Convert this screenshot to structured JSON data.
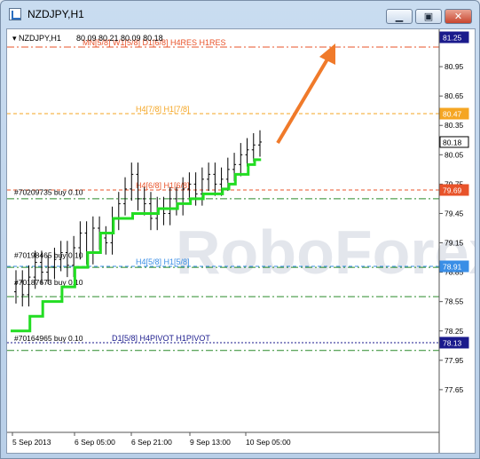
{
  "window": {
    "title": "NZDJPY,H1"
  },
  "chart_data": {
    "type": "line",
    "title": "NZDJPY,H1",
    "ohlc_label": "80.09 80.21 80.09 80.18",
    "symbol_label": "NZDJPY,H1",
    "ylim": [
      77.25,
      81.25
    ],
    "y_ticks": [
      "81.25",
      "80.95",
      "80.65",
      "80.35",
      "80.05",
      "79.75",
      "79.45",
      "79.15",
      "78.85",
      "78.55",
      "78.25",
      "77.95",
      "77.65"
    ],
    "x_ticks": [
      "5 Sep 2013",
      "6 Sep 05:00",
      "6 Sep 21:00",
      "9 Sep 13:00",
      "10 Sep 05:00"
    ],
    "price_tags": [
      {
        "value": 81.25,
        "label": "81.25",
        "color": "#1a1a8c"
      },
      {
        "value": 80.47,
        "label": "80.47",
        "color": "#f5a623"
      },
      {
        "value": 80.18,
        "label": "80.18",
        "color": "#ffffff"
      },
      {
        "value": 79.69,
        "label": "79.69",
        "color": "#e8532a"
      },
      {
        "value": 78.91,
        "label": "78.91",
        "color": "#3a8ee6"
      },
      {
        "value": 78.13,
        "label": "78.13",
        "color": "#1a1a8c"
      }
    ],
    "levels": [
      {
        "value": 81.15,
        "label": "MN[5/8] W1[5/8] D1[6/8] H4RES H1RES",
        "color": "#e8532a",
        "style": "dashdot"
      },
      {
        "value": 80.47,
        "label": "H4[7/8] H1[7/8]",
        "color": "#f5a623",
        "style": "dash"
      },
      {
        "value": 79.69,
        "label": "H4[6/8] H1[6/8]",
        "color": "#e8532a",
        "style": "dash"
      },
      {
        "value": 78.91,
        "label": "H4[5/8] H1[5/8]",
        "color": "#3a8ee6",
        "style": "dash"
      },
      {
        "value": 78.13,
        "label": "D1[5/8] H4PIVOT H1PIVOT",
        "color": "#1a1a8c",
        "style": "dot"
      }
    ],
    "order_labels": [
      {
        "value": 79.62,
        "label": "#70209735 buy 0.10"
      },
      {
        "value": 78.98,
        "label": "#70198465 buy 0.10"
      },
      {
        "value": 78.7,
        "label": "#70187673 buy 0.10"
      },
      {
        "value": 78.13,
        "label": "#70164965 buy 0.10"
      }
    ],
    "green_dashdot_levels": [
      79.6,
      78.9,
      78.6,
      78.05
    ],
    "watermark": "RoboForex",
    "closes": [
      78.75,
      78.62,
      78.8,
      78.95,
      78.85,
      78.9,
      78.98,
      79.05,
      78.92,
      79.1,
      79.25,
      79.05,
      79.3,
      79.2,
      79.15,
      79.4,
      79.55,
      79.7,
      79.85,
      79.6,
      79.55,
      79.4,
      79.5,
      79.45,
      79.6,
      79.55,
      79.7,
      79.75,
      79.65,
      79.8,
      79.85,
      79.75,
      79.8,
      79.9,
      79.95,
      80.05,
      80.1,
      80.15,
      80.18
    ],
    "trail_stop": [
      78.25,
      78.25,
      78.25,
      78.4,
      78.4,
      78.55,
      78.55,
      78.55,
      78.7,
      78.7,
      78.9,
      78.9,
      79.05,
      79.05,
      79.25,
      79.25,
      79.4,
      79.4,
      79.4,
      79.45,
      79.45,
      79.45,
      79.45,
      79.5,
      79.5,
      79.5,
      79.55,
      79.55,
      79.6,
      79.6,
      79.65,
      79.65,
      79.65,
      79.7,
      79.75,
      79.85,
      79.85,
      79.95,
      80.0
    ]
  }
}
